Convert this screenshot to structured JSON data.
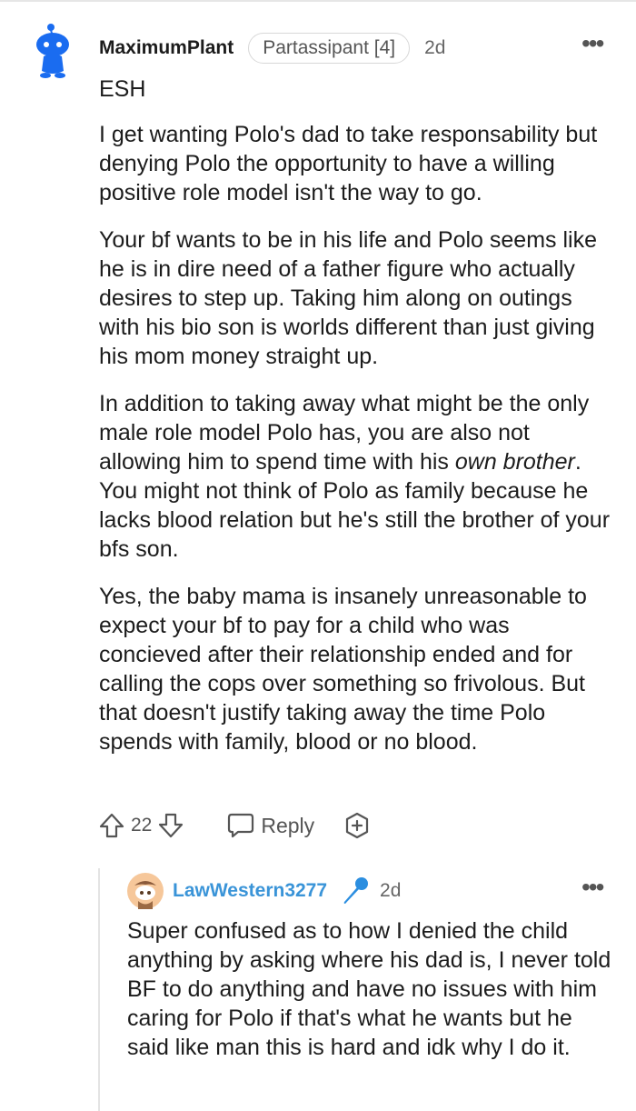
{
  "comment": {
    "username": "MaximumPlant",
    "flair": "Partassipant [4]",
    "time": "2d",
    "paragraphs": [
      "ESH",
      "I get wanting Polo's dad to take responsability but denying Polo the opportunity to have a willing positive role model isn't the way to go.",
      "Your bf wants to be in his life and Polo seems like he is in dire need of a father figure who actually desires to step up. Taking him along on outings with his bio son is worlds different than just giving his mom money straight up.",
      {
        "before": "In addition to taking away what might be the only male role model Polo has, you are also not allowing him to spend time with his ",
        "emphasis": "own brother",
        "after": ". You might not think of Polo as family because he lacks blood relation but he's still the brother of your bfs son."
      },
      "Yes, the baby mama is insanely unreasonable to expect your bf to pay for a child who was concieved after their relationship ended and for calling the cops over something so frivolous. But that doesn't justify taking away the time Polo spends with family, blood or no blood."
    ],
    "score": "22",
    "reply_label": "Reply"
  },
  "reply": {
    "username": "LawWestern3277",
    "time": "2d",
    "text": "Super confused as to how I denied the child anything by asking where his dad is, I never told BF to do anything and have no issues with him caring for Polo if that's what he wants but he said like man this is hard and idk why I do it."
  },
  "icons": {
    "avatar1": "snoo-avatar-blue",
    "upvote": "arrow-up-outline-icon",
    "downvote": "arrow-down-outline-icon",
    "reply": "speech-bubble-icon",
    "award": "award-plus-icon",
    "more": "ellipsis-icon",
    "avatar2": "snoo-avatar-orange",
    "mic": "microphone-icon"
  },
  "colors": {
    "username_reply": "#3a94d8",
    "avatar_blue": "#1a6cf0",
    "avatar_orange": "#f6c79a"
  }
}
